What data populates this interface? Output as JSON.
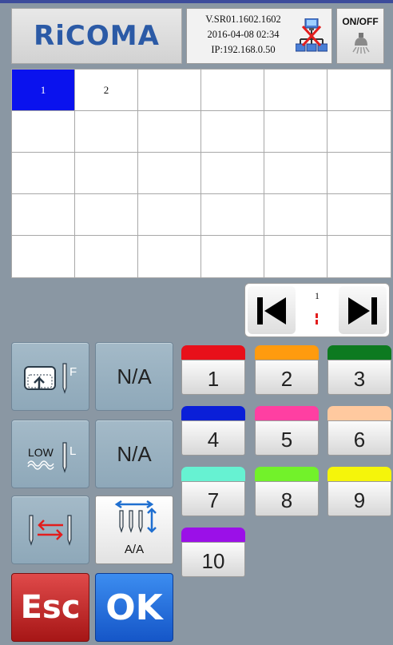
{
  "header": {
    "logo_text": "RiCOMA",
    "version": "V.SR01.1602.1602",
    "datetime": "2016-04-08  02:34",
    "ip": "IP:192.168.0.50",
    "network_icon": "network-disconnected-icon",
    "onoff_label": "ON/OFF",
    "lamp_icon": "lamp-icon"
  },
  "grid": {
    "cells": [
      "1",
      "2",
      "",
      "",
      "",
      "",
      "",
      "",
      "",
      "",
      "",
      "",
      "",
      "",
      "",
      "",
      "",
      "",
      "",
      "",
      "",
      "",
      "",
      "",
      "",
      "",
      "",
      "",
      "",
      ""
    ],
    "selected_color": "#0a12ee"
  },
  "pager": {
    "page": "1",
    "first_icon": "first-page-icon",
    "last_icon": "last-page-icon"
  },
  "functions": {
    "frame_up_label": "F",
    "na_label_1": "N/A",
    "low_text": "LOW",
    "low_label": "L",
    "na_label_2": "N/A",
    "aa_label": "A/A"
  },
  "color_keys": [
    {
      "label": "1",
      "color": "#e8101a"
    },
    {
      "label": "2",
      "color": "#ff9b0e"
    },
    {
      "label": "3",
      "color": "#0d7a20"
    },
    {
      "label": "4",
      "color": "#0a1fd8"
    },
    {
      "label": "5",
      "color": "#ff3fa2"
    },
    {
      "label": "6",
      "color": "#ffc99f"
    },
    {
      "label": "7",
      "color": "#66f2d2"
    },
    {
      "label": "8",
      "color": "#72f22a"
    },
    {
      "label": "9",
      "color": "#f5f50a"
    },
    {
      "label": "10",
      "color": "#9b10e8"
    }
  ],
  "actions": {
    "esc_label": "Esc",
    "ok_label": "OK"
  }
}
